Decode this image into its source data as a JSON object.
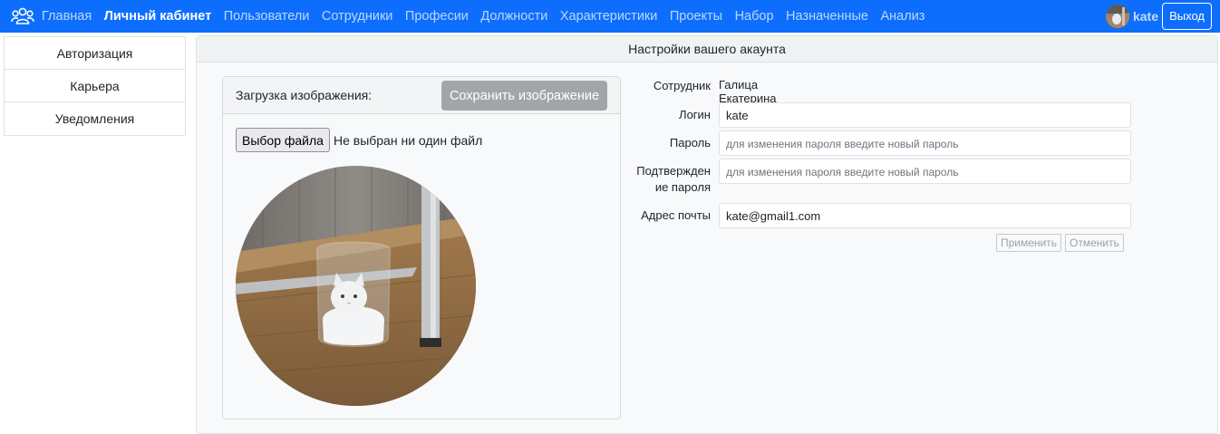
{
  "nav": {
    "items": [
      {
        "label": "Главная",
        "active": false
      },
      {
        "label": "Личный кабинет",
        "active": true
      },
      {
        "label": "Пользователи",
        "active": false
      },
      {
        "label": "Сотрудники",
        "active": false
      },
      {
        "label": "Професии",
        "active": false
      },
      {
        "label": "Должности",
        "active": false
      },
      {
        "label": "Характеристики",
        "active": false
      },
      {
        "label": "Проекты",
        "active": false
      },
      {
        "label": "Набор",
        "active": false
      },
      {
        "label": "Назначенные",
        "active": false
      },
      {
        "label": "Анализ",
        "active": false
      }
    ],
    "username": "kate",
    "logout_label": "Выход",
    "accent": "#0d6efd"
  },
  "sidebar": {
    "items": [
      {
        "label": "Авторизация"
      },
      {
        "label": "Карьера"
      },
      {
        "label": "Уведомления"
      }
    ]
  },
  "main": {
    "title": "Настройки вашего акаунта"
  },
  "upload": {
    "title": "Загрузка изображения:",
    "save_label": "Сохранить изображение",
    "file_button": "Выбор файла",
    "file_status": "Не выбран ни один файл"
  },
  "form": {
    "employee_label": "Сотрудник",
    "employee_value": "Галица Екатерина",
    "login_label": "Логин",
    "login_value": "kate",
    "password_label": "Пароль",
    "password_placeholder": "для изменения пароля введите новый пароль",
    "confirm_label_1": "Подтвержден",
    "confirm_label_2": "ие пароля",
    "confirm_placeholder": "для изменения пароля введите новый пароль",
    "email_label": "Адрес почты",
    "email_value": "kate@gmail1.com",
    "apply_label": "Применить",
    "cancel_label": "Отменить"
  }
}
